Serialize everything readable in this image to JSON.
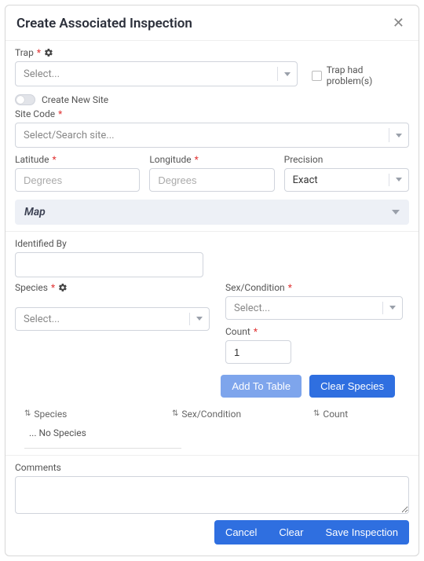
{
  "header": {
    "title": "Create Associated Inspection"
  },
  "trap": {
    "label": "Trap",
    "placeholder": "Select...",
    "problem_label": "Trap had problem(s)"
  },
  "site": {
    "create_toggle_label": "Create New Site",
    "code_label": "Site Code",
    "code_placeholder": "Select/Search site..."
  },
  "lat": {
    "label": "Latitude",
    "placeholder": "Degrees"
  },
  "lon": {
    "label": "Longitude",
    "placeholder": "Degrees"
  },
  "precision": {
    "label": "Precision",
    "value": "Exact"
  },
  "map": {
    "label": "Map"
  },
  "identified_by": {
    "label": "Identified By"
  },
  "species": {
    "label": "Species",
    "placeholder": "Select..."
  },
  "sex": {
    "label": "Sex/Condition",
    "placeholder": "Select..."
  },
  "count": {
    "label": "Count",
    "value": "1"
  },
  "buttons": {
    "add_to_table": "Add To Table",
    "clear_species": "Clear Species"
  },
  "table": {
    "col_species": "Species",
    "col_sex": "Sex/Condition",
    "col_count": "Count",
    "empty": "... No Species"
  },
  "comments": {
    "label": "Comments"
  },
  "footer": {
    "cancel": "Cancel",
    "clear": "Clear",
    "save": "Save Inspection"
  }
}
